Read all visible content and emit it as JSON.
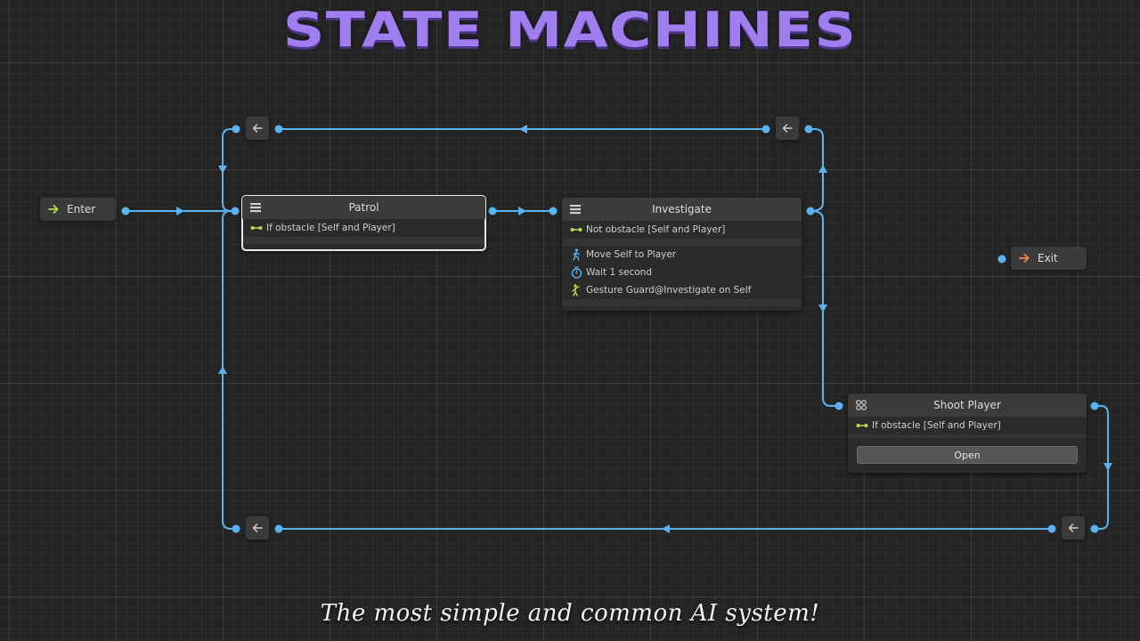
{
  "title": "STATE MACHINES",
  "subtitle": "The most simple and common AI system!",
  "colors": {
    "wire": "#5ab2f0",
    "condition": "#b6e04a",
    "enter_arrow": "#b6e04a",
    "exit_arrow": "#f08a50",
    "title": "#a07ef0"
  },
  "enter": {
    "label": "Enter",
    "icon": "arrow-right-icon"
  },
  "exit": {
    "label": "Exit",
    "icon": "arrow-right-icon"
  },
  "nodes": {
    "patrol": {
      "title": "Patrol",
      "icon": "hamburger-menu-icon",
      "condition": "If obstacle [Self and Player]"
    },
    "investigate": {
      "title": "Investigate",
      "icon": "hamburger-menu-icon",
      "condition": "Not obstacle [Self and Player]",
      "actions": [
        {
          "label": "Move Self to Player",
          "icon": "walking-person-icon"
        },
        {
          "label": "Wait 1 second",
          "icon": "stopwatch-icon"
        },
        {
          "label": "Gesture Guard@Investigate on Self",
          "icon": "gesture-person-icon"
        }
      ]
    },
    "shoot_player": {
      "title": "Shoot Player",
      "icon": "trigger-icon",
      "condition": "If obstacle [Self and Player]",
      "button": "Open"
    }
  },
  "relay_icon": "arrow-left-icon"
}
